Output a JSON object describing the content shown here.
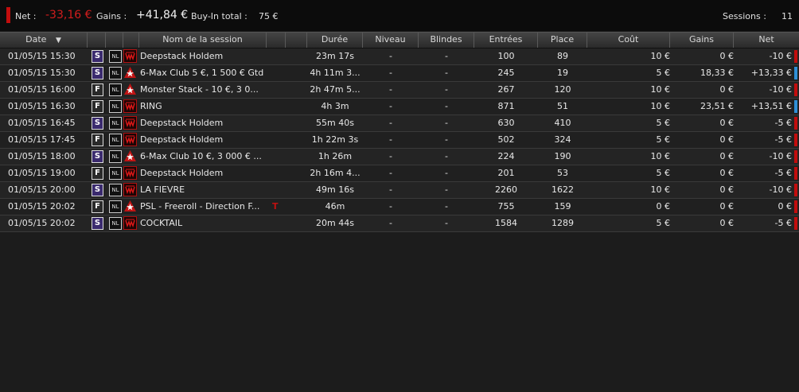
{
  "summary": {
    "net_label": "Net :",
    "net_value": "-33,16 €",
    "gains_label": "Gains :",
    "gains_value": "+41,84 €",
    "buyin_label": "Buy-In total :",
    "buyin_value": "75 €",
    "sessions_label": "Sessions :",
    "sessions_value": "11"
  },
  "columns": {
    "date": "Date",
    "sort_indicator": "▼",
    "name": "Nom de la session",
    "duration": "Durée",
    "level": "Niveau",
    "blinds": "Blindes",
    "entries": "Entrées",
    "place": "Place",
    "cost": "Coût",
    "gains": "Gains",
    "net": "Net"
  },
  "colors": {
    "negative": "#c20d0d",
    "positive": "#2f8fd6",
    "sitngo_badge": "#3a2a6e"
  },
  "rows": [
    {
      "date": "01/05/15 15:30",
      "type": "S",
      "game": "NL",
      "room": "winamax",
      "name": "Deepstack Holdem",
      "tag": "",
      "duration": "23m 17s",
      "level": "-",
      "blinds": "-",
      "entries": "100",
      "place": "89",
      "cost": "10 €",
      "gains": "0 €",
      "net": "-10 €",
      "result": "negative"
    },
    {
      "date": "01/05/15 15:30",
      "type": "S",
      "game": "NL",
      "room": "pokerstars",
      "name": "6-Max Club 5 €, 1 500 € Gtd",
      "tag": "",
      "duration": "4h 11m 3...",
      "level": "-",
      "blinds": "-",
      "entries": "245",
      "place": "19",
      "cost": "5 €",
      "gains": "18,33 €",
      "net": "+13,33 €",
      "result": "positive"
    },
    {
      "date": "01/05/15 16:00",
      "type": "F",
      "game": "NL",
      "room": "pokerstars",
      "name": "Monster Stack - 10 €, 3 0...",
      "tag": "",
      "duration": "2h 47m 5...",
      "level": "-",
      "blinds": "-",
      "entries": "267",
      "place": "120",
      "cost": "10 €",
      "gains": "0 €",
      "net": "-10 €",
      "result": "negative"
    },
    {
      "date": "01/05/15 16:30",
      "type": "F",
      "game": "NL",
      "room": "winamax",
      "name": "RING",
      "tag": "",
      "duration": "4h 3m",
      "level": "-",
      "blinds": "-",
      "entries": "871",
      "place": "51",
      "cost": "10 €",
      "gains": "23,51 €",
      "net": "+13,51 €",
      "result": "positive"
    },
    {
      "date": "01/05/15 16:45",
      "type": "S",
      "game": "NL",
      "room": "winamax",
      "name": "Deepstack Holdem",
      "tag": "",
      "duration": "55m 40s",
      "level": "-",
      "blinds": "-",
      "entries": "630",
      "place": "410",
      "cost": "5 €",
      "gains": "0 €",
      "net": "-5 €",
      "result": "negative"
    },
    {
      "date": "01/05/15 17:45",
      "type": "F",
      "game": "NL",
      "room": "winamax",
      "name": "Deepstack Holdem",
      "tag": "",
      "duration": "1h 22m 3s",
      "level": "-",
      "blinds": "-",
      "entries": "502",
      "place": "324",
      "cost": "5 €",
      "gains": "0 €",
      "net": "-5 €",
      "result": "negative"
    },
    {
      "date": "01/05/15 18:00",
      "type": "S",
      "game": "NL",
      "room": "pokerstars",
      "name": "6-Max Club 10 €, 3 000 € ...",
      "tag": "",
      "duration": "1h 26m",
      "level": "-",
      "blinds": "-",
      "entries": "224",
      "place": "190",
      "cost": "10 €",
      "gains": "0 €",
      "net": "-10 €",
      "result": "negative"
    },
    {
      "date": "01/05/15 19:00",
      "type": "F",
      "game": "NL",
      "room": "winamax",
      "name": "Deepstack Holdem",
      "tag": "",
      "duration": "2h 16m 4...",
      "level": "-",
      "blinds": "-",
      "entries": "201",
      "place": "53",
      "cost": "5 €",
      "gains": "0 €",
      "net": "-5 €",
      "result": "negative"
    },
    {
      "date": "01/05/15 20:00",
      "type": "S",
      "game": "NL",
      "room": "winamax",
      "name": "LA FIEVRE",
      "tag": "",
      "duration": "49m 16s",
      "level": "-",
      "blinds": "-",
      "entries": "2260",
      "place": "1622",
      "cost": "10 €",
      "gains": "0 €",
      "net": "-10 €",
      "result": "negative"
    },
    {
      "date": "01/05/15 20:02",
      "type": "F",
      "game": "NL",
      "room": "pokerstars",
      "name": "PSL - Freeroll - Direction F...",
      "tag": "T",
      "duration": "46m",
      "level": "-",
      "blinds": "-",
      "entries": "755",
      "place": "159",
      "cost": "0 €",
      "gains": "0 €",
      "net": "0 €",
      "result": "negative"
    },
    {
      "date": "01/05/15 20:02",
      "type": "S",
      "game": "NL",
      "room": "winamax",
      "name": "COCKTAIL",
      "tag": "",
      "duration": "20m 44s",
      "level": "-",
      "blinds": "-",
      "entries": "1584",
      "place": "1289",
      "cost": "5 €",
      "gains": "0 €",
      "net": "-5 €",
      "result": "negative"
    }
  ]
}
